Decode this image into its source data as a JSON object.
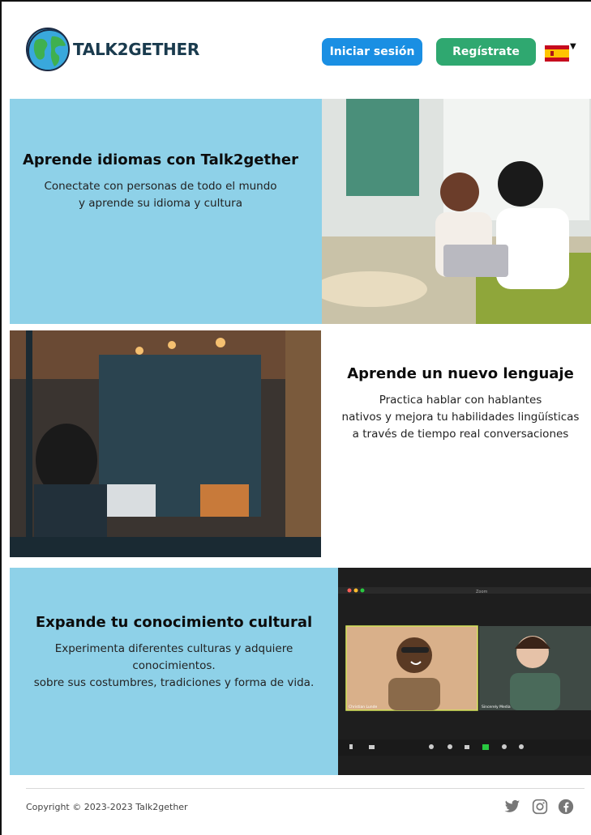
{
  "header": {
    "brand": "TALK2GETHER",
    "login_label": "Iniciar sesión",
    "register_label": "Regístrate",
    "language_flag": "spain-flag-icon"
  },
  "sections": [
    {
      "title": "Aprende idiomas con Talk2gether",
      "text_lines": [
        "Conectate con personas de todo el mundo",
        "y aprende su idioma y cultura"
      ],
      "image": "two women looking at a laptop"
    },
    {
      "title": "Aprende un nuevo lenguaje",
      "text_lines": [
        "Practica hablar con hablantes",
        "nativos y mejora tu habilidades lingüísticas",
        "a través de tiempo  real conversaciones"
      ],
      "image": "person using laptop at a cafe window"
    },
    {
      "title": "Expande tu conocimiento cultural",
      "text_lines": [
        "Experimenta diferentes culturas y adquiere",
        "conocimientos.",
        "sobre sus costumbres, tradiciones y forma de vida."
      ],
      "image": "video call screenshot",
      "call": {
        "window_title": "Zoom",
        "participant_1": "Christian Lunde",
        "participant_2": "Sincerely Media"
      }
    }
  ],
  "footer": {
    "copyright": "Copyright © 2023-2023 Talk2gether",
    "social": [
      "twitter-icon",
      "instagram-icon",
      "facebook-icon"
    ]
  },
  "colors": {
    "section_bg": "#8ed1e8",
    "login_button": "#1a8fe3",
    "register_button": "#2fa870",
    "brand_text": "#1a3b4e"
  }
}
